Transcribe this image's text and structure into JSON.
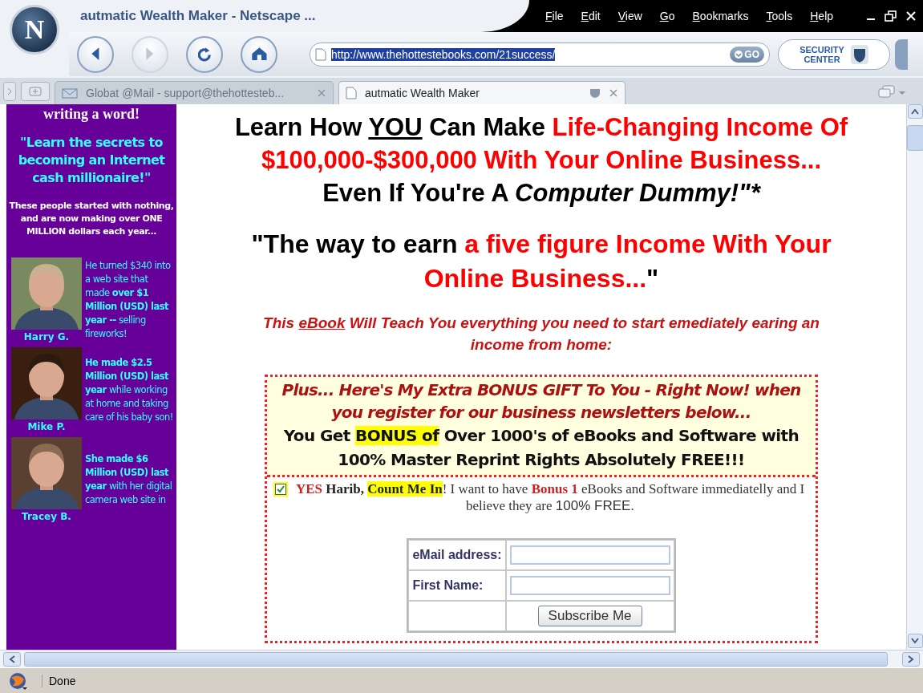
{
  "window": {
    "logo": "N",
    "title": "autmatic Wealth Maker - Netscape ...",
    "menu": [
      {
        "label": "File"
      },
      {
        "label": "Edit"
      },
      {
        "label": "View"
      },
      {
        "label": "Go"
      },
      {
        "label": "Bookmarks"
      },
      {
        "label": "Tools"
      },
      {
        "label": "Help"
      }
    ],
    "nav_buttons": [
      {
        "kind": "back",
        "disabled": false
      },
      {
        "kind": "forward",
        "disabled": true
      },
      {
        "kind": "reload",
        "disabled": false
      },
      {
        "kind": "home",
        "disabled": false
      }
    ],
    "url": "http://www.thehottestebooks.com/21success/",
    "go_label": "GO",
    "security_lines": [
      "SECURITY",
      "CENTER"
    ]
  },
  "tabs": [
    {
      "label": "Globat @Mail - support@thehottesteb...",
      "kind": "mail",
      "selected": false
    },
    {
      "label": "autmatic Wealth Maker",
      "kind": "page",
      "selected": true
    }
  ],
  "sidebar": {
    "intro": "writing a word!",
    "quote": "\"Learn the secrets to becoming an Internet cash millionaire!\"",
    "subtext": "These people started with nothing, and are now making over ONE MILLION dollars each year...",
    "testimonials": [
      {
        "name": "Harry G.",
        "story": "He turned $340 into a web site that made **over $1 Million (USD) last year --** selling fireworks!"
      },
      {
        "name": "Mike P.",
        "story": "**He made $2.5 Million (USD) last year** while working at home and taking care of his baby son!"
      },
      {
        "name": "Tracey B.",
        "story": "**She made $6 Million (USD) last year** with her digital camera web site in"
      }
    ]
  },
  "main": {
    "headline": [
      [
        {
          "text": "Learn How ",
          "kind": "plain"
        },
        {
          "text": "YOU",
          "kind": "underline"
        },
        {
          "text": " Can Make ",
          "kind": "plain"
        },
        {
          "text": "Life-Changing Income Of",
          "kind": "red"
        }
      ],
      [
        {
          "text": "$100,000-$300,000 With Your Online Business...",
          "kind": "red"
        }
      ],
      [
        {
          "text": "Even If You're A ",
          "kind": "plain"
        },
        {
          "text": "Computer Dummy!\"*",
          "kind": "italic"
        }
      ]
    ],
    "subheadline": [
      [
        {
          "text": "\"The way to earn ",
          "kind": "plain"
        },
        {
          "text": "a five figure Income With Your",
          "kind": "red"
        }
      ],
      [
        {
          "text": "Online Business...",
          "kind": "red"
        },
        {
          "text": "\"",
          "kind": "plain"
        }
      ]
    ],
    "intro": [
      [
        {
          "text": "This ",
          "kind": "plain"
        },
        {
          "text": "eBook",
          "kind": "underline"
        },
        {
          "text": " Will Teach You everything you need to start emediately earing an",
          "kind": "plain"
        }
      ],
      [
        {
          "text": "income from home:",
          "kind": "plain"
        }
      ]
    ],
    "bonus": {
      "offer": "Plus... Here's My Extra BONUS GIFT To You - Right Now! when you register for our business newsletters below...",
      "benefit": [
        {
          "text": "You Get ",
          "kind": "plain"
        },
        {
          "text": "BONUS of",
          "kind": "highlight"
        },
        {
          "text": " Over 1000's of eBooks and Software with 100% Master Reprint Rights Absolutely FREE!!!",
          "kind": "plain"
        }
      ]
    },
    "consent": {
      "checked": true,
      "text": [
        {
          "text": "YES",
          "kind": "red-bold"
        },
        {
          "text": " Harib, ",
          "kind": "bold"
        },
        {
          "text": "Count Me In",
          "kind": "highlight"
        },
        {
          "text": "! I want to have ",
          "kind": "plain"
        },
        {
          "text": "Bonus 1",
          "kind": "red-bold"
        },
        {
          "text": " eBooks and Software immediatelly and I believe they are  ",
          "kind": "plain"
        },
        {
          "text": "100% FREE.",
          "kind": "sans"
        }
      ]
    },
    "form": {
      "fields": [
        {
          "label": "eMail address:"
        },
        {
          "label": "First Name:"
        }
      ],
      "submit": "Subscribe Me"
    }
  },
  "status_bar": {
    "text": "Done"
  }
}
